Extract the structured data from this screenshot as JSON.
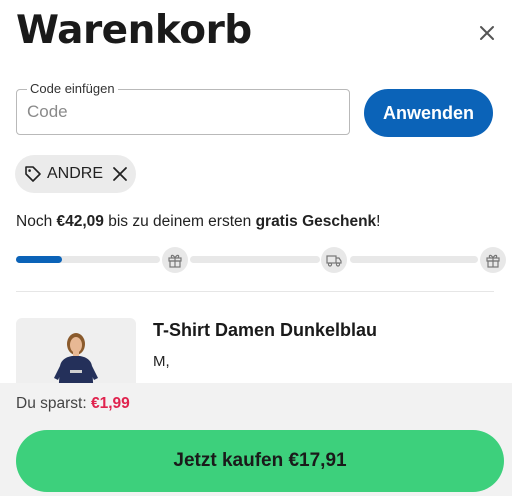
{
  "header": {
    "title": "Warenkorb",
    "close_icon": "close-icon"
  },
  "coupon": {
    "legend": "Code einfügen",
    "placeholder": "Code",
    "value": "",
    "apply_label": "Anwenden",
    "applied_code": "ANDRE",
    "tag_icon": "tag-icon",
    "remove_icon": "close-icon"
  },
  "progress": {
    "prefix": "Noch ",
    "amount": "€42,09",
    "middle": " bis zu deinem ersten ",
    "goal": "gratis Geschenk",
    "suffix": "!",
    "fraction": 0.1,
    "milestones": [
      "gift-icon",
      "truck-icon",
      "gift-icon"
    ]
  },
  "cart": {
    "items": [
      {
        "name": "T-Shirt Damen Dunkelblau",
        "variant": "M,"
      }
    ]
  },
  "footer": {
    "savings_label": "Du sparst: ",
    "savings_amount": "€1,99",
    "buy_label": "Jetzt kaufen €17,91"
  },
  "colors": {
    "primary": "#0b63b8",
    "cta": "#3dd07c",
    "savings": "#e0234e"
  }
}
